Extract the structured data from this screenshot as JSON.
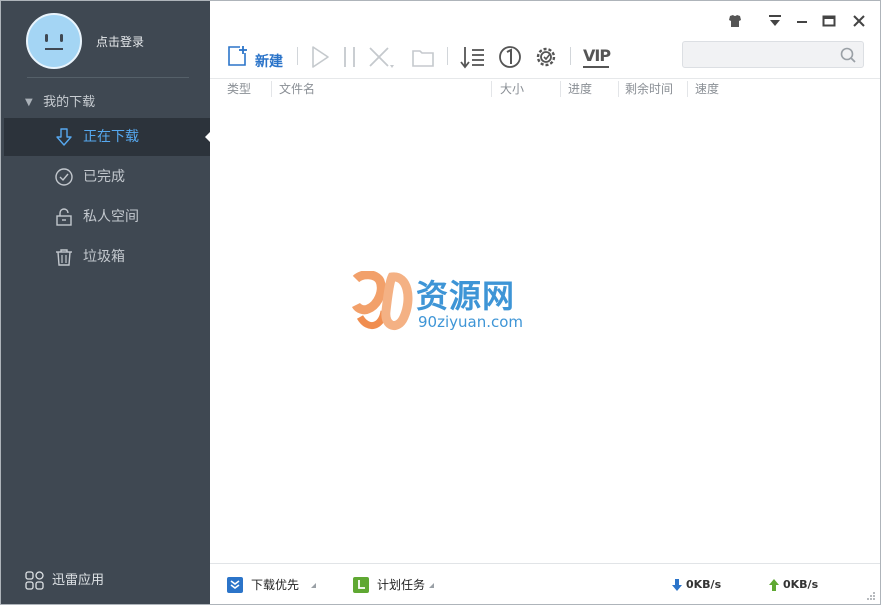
{
  "sidebar": {
    "login_text": "点击登录",
    "group_label": "我的下载",
    "items": [
      {
        "label": "正在下载",
        "icon": "download-arrow-icon",
        "active": true
      },
      {
        "label": "已完成",
        "icon": "check-circle-icon",
        "active": false
      },
      {
        "label": "私人空间",
        "icon": "lock-icon",
        "active": false
      },
      {
        "label": "垃圾箱",
        "icon": "trash-icon",
        "active": false
      }
    ],
    "apps_label": "迅雷应用"
  },
  "toolbar": {
    "new_label": "新建",
    "buttons": [
      "start-icon",
      "pause-icon",
      "delete-icon",
      "open-folder-icon",
      "sort-icon",
      "single-task-icon",
      "settings-icon",
      "vip-icon"
    ],
    "vip_label": "VIP"
  },
  "window_controls": [
    "skin-icon",
    "menu-icon",
    "minimize-icon",
    "maximize-icon",
    "close-icon"
  ],
  "search": {
    "value": "",
    "placeholder": ""
  },
  "columns": [
    "类型",
    "文件名",
    "大小",
    "进度",
    "剩余时间",
    "速度"
  ],
  "watermark": {
    "title": "资源网",
    "subtitle": "90ziyuan.com"
  },
  "statusbar": {
    "download_priority": "下载优先",
    "scheduled_tasks": "计划任务",
    "download_speed": "0KB/s",
    "upload_speed": "0KB/s"
  },
  "colors": {
    "sidebar_bg": "#3f4852",
    "active_item_bg": "#2c333b",
    "accent_blue": "#2b74c9",
    "download_green": "#5fa832"
  }
}
